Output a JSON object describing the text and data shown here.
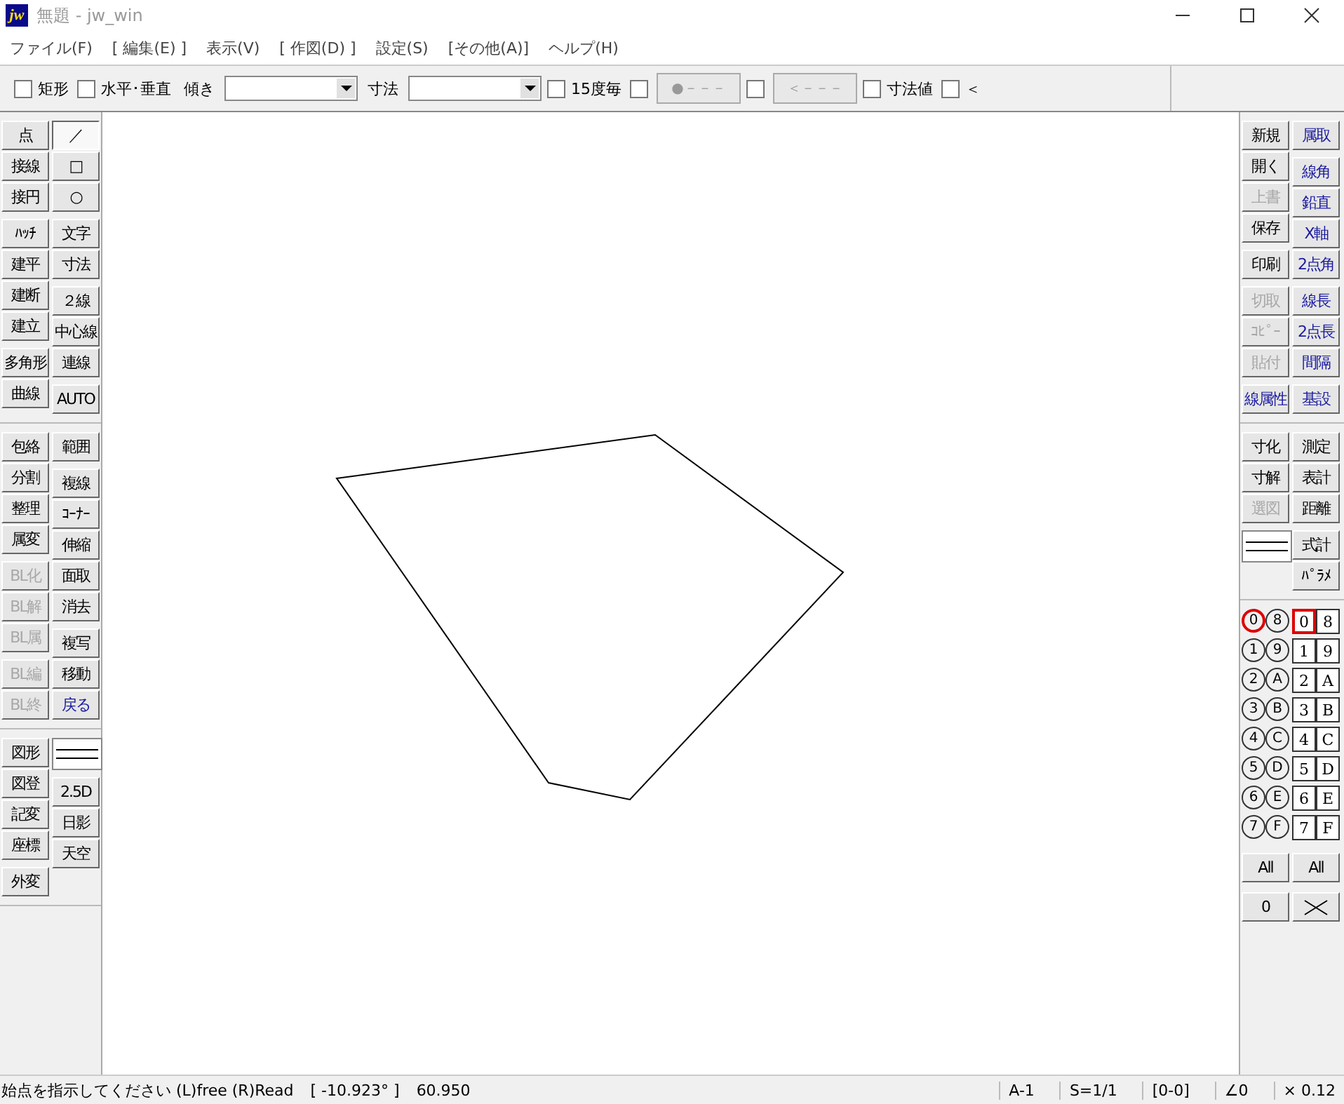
{
  "window": {
    "logo": "jw",
    "title": "無題 - jw_win"
  },
  "menu": [
    "ファイル(F)",
    "[ 編集(E) ]",
    "表示(V)",
    "[ 作図(D) ]",
    "設定(S)",
    "[その他(A)]",
    "ヘルプ(H)"
  ],
  "toolbar": [
    {
      "kind": "checkbox",
      "label": "矩形",
      "checked": false
    },
    {
      "kind": "checkbox",
      "label": "水平･垂直",
      "checked": false
    },
    {
      "kind": "label",
      "label": "傾き"
    },
    {
      "kind": "combo"
    },
    {
      "kind": "label",
      "label": "寸法"
    },
    {
      "kind": "combo"
    },
    {
      "kind": "checkbox",
      "label": "15度毎",
      "checked": false
    },
    {
      "kind": "checkbox",
      "checked": false
    },
    {
      "kind": "button",
      "label": "●－－－",
      "disabled": true
    },
    {
      "kind": "checkbox",
      "checked": false
    },
    {
      "kind": "button",
      "label": "＜－－－",
      "disabled": true
    },
    {
      "kind": "checkbox",
      "label": "寸法値",
      "checked": false
    },
    {
      "kind": "checkbox",
      "label": "＜",
      "checked": false
    }
  ],
  "left_panel": [
    {
      "col1": [
        [
          {
            "label": "点",
            "disabled": false,
            "accent": false
          },
          {
            "label": "接線",
            "disabled": false,
            "accent": false
          },
          {
            "label": "接円",
            "disabled": false,
            "accent": false
          }
        ],
        [
          {
            "label": "ﾊｯﾁ",
            "disabled": false,
            "accent": false
          },
          {
            "label": "建平",
            "disabled": false,
            "accent": false
          },
          {
            "label": "建断",
            "disabled": false,
            "accent": false
          },
          {
            "label": "建立",
            "disabled": false,
            "accent": false
          }
        ],
        [
          {
            "label": "多角形",
            "disabled": false,
            "accent": false
          },
          {
            "label": "曲線",
            "disabled": false,
            "accent": false
          }
        ]
      ],
      "col2": [
        [
          {
            "label": "／",
            "disabled": false,
            "accent": false,
            "selected": true
          },
          {
            "label": "□",
            "disabled": false,
            "accent": false,
            "selected": false
          },
          {
            "label": "○",
            "disabled": false,
            "accent": false,
            "selected": false
          }
        ],
        [
          {
            "label": "文字",
            "disabled": false,
            "accent": false
          },
          {
            "label": "寸法",
            "disabled": false,
            "accent": false
          }
        ],
        [
          {
            "label": "２線",
            "disabled": false,
            "accent": false
          },
          {
            "label": "中心線",
            "disabled": false,
            "accent": false
          },
          {
            "label": "連線",
            "disabled": false,
            "accent": false
          }
        ],
        [
          {
            "label": "AUTO",
            "disabled": false,
            "accent": false
          }
        ]
      ]
    },
    {
      "col1": [
        [
          {
            "label": "包絡",
            "disabled": false,
            "accent": false
          },
          {
            "label": "分割",
            "disabled": false,
            "accent": false
          },
          {
            "label": "整理",
            "disabled": false,
            "accent": false
          },
          {
            "label": "属変",
            "disabled": false,
            "accent": false
          }
        ],
        [
          {
            "label": "BL化",
            "disabled": true,
            "accent": false
          },
          {
            "label": "BL解",
            "disabled": true,
            "accent": false
          },
          {
            "label": "BL属",
            "disabled": true,
            "accent": false
          }
        ],
        [
          {
            "label": "BL編",
            "disabled": true,
            "accent": false
          },
          {
            "label": "BL終",
            "disabled": true,
            "accent": false
          }
        ]
      ],
      "col2": [
        [
          {
            "label": "範囲",
            "disabled": false,
            "accent": false
          }
        ],
        [
          {
            "label": "複線",
            "disabled": false,
            "accent": false
          },
          {
            "label": "ｺｰﾅｰ",
            "disabled": false,
            "accent": false
          },
          {
            "label": "伸縮",
            "disabled": false,
            "accent": false
          },
          {
            "label": "面取",
            "disabled": false,
            "accent": false
          },
          {
            "label": "消去",
            "disabled": false,
            "accent": false
          }
        ],
        [
          {
            "label": "複写",
            "disabled": false,
            "accent": false
          },
          {
            "label": "移動",
            "disabled": false,
            "accent": false
          },
          {
            "label": "戻る",
            "disabled": false,
            "accent": true
          }
        ]
      ]
    },
    {
      "col1": [
        [
          {
            "label": "図形",
            "disabled": false,
            "accent": false
          },
          {
            "label": "図登",
            "disabled": false,
            "accent": false
          },
          {
            "label": "記変",
            "disabled": false,
            "accent": false
          },
          {
            "label": "座標",
            "disabled": false,
            "accent": false
          }
        ],
        [
          {
            "label": "外変",
            "disabled": false,
            "accent": false
          }
        ]
      ],
      "col2": [
        [
          {
            "kind": "swatch"
          }
        ],
        [
          {
            "label": "2.5D",
            "disabled": false,
            "accent": false
          },
          {
            "label": "日影",
            "disabled": false,
            "accent": false
          },
          {
            "label": "天空",
            "disabled": false,
            "accent": false
          }
        ]
      ]
    }
  ],
  "right_panel": [
    {
      "col1": [
        [
          {
            "label": "新規",
            "disabled": false,
            "accent": false
          },
          {
            "label": "開く",
            "disabled": false,
            "accent": false
          },
          {
            "label": "上書",
            "disabled": true,
            "accent": false
          },
          {
            "label": "保存",
            "disabled": false,
            "accent": false
          }
        ],
        [
          {
            "label": "印刷",
            "disabled": false,
            "accent": false
          }
        ],
        [
          {
            "label": "切取",
            "disabled": true,
            "accent": false
          },
          {
            "label": "ｺﾋﾟｰ",
            "disabled": true,
            "accent": false
          },
          {
            "label": "貼付",
            "disabled": true,
            "accent": false
          }
        ],
        [
          {
            "label": "線属性",
            "disabled": false,
            "accent": true
          }
        ]
      ],
      "col2": [
        [
          {
            "label": "属取",
            "disabled": false,
            "accent": true
          }
        ],
        [
          {
            "label": "線角",
            "disabled": false,
            "accent": true
          },
          {
            "label": "鉛直",
            "disabled": false,
            "accent": true
          },
          {
            "label": "X軸",
            "disabled": false,
            "accent": true
          },
          {
            "label": "2点角",
            "disabled": false,
            "accent": true
          }
        ],
        [
          {
            "label": "線長",
            "disabled": false,
            "accent": true
          },
          {
            "label": "2点長",
            "disabled": false,
            "accent": true
          },
          {
            "label": "間隔",
            "disabled": false,
            "accent": true
          }
        ],
        [
          {
            "label": "基設",
            "disabled": false,
            "accent": true
          }
        ]
      ]
    },
    {
      "col1": [
        [
          {
            "label": "寸化",
            "disabled": false,
            "accent": false
          },
          {
            "label": "寸解",
            "disabled": false,
            "accent": false
          },
          {
            "label": "選図",
            "disabled": true,
            "accent": false
          }
        ],
        [
          {
            "kind": "swatch"
          }
        ]
      ],
      "col2": [
        [
          {
            "label": "測定",
            "disabled": false,
            "accent": false
          },
          {
            "label": "表計",
            "disabled": false,
            "accent": false
          },
          {
            "label": "距離",
            "disabled": false,
            "accent": false
          }
        ],
        [
          {
            "label": "式計",
            "disabled": false,
            "accent": false
          },
          {
            "label": "ﾊﾟﾗﾒ",
            "disabled": false,
            "accent": false
          }
        ]
      ]
    }
  ],
  "layers": {
    "groups": [
      {
        "label": "0",
        "selected": true
      },
      {
        "label": "1",
        "selected": false
      },
      {
        "label": "2",
        "selected": false
      },
      {
        "label": "3",
        "selected": false
      },
      {
        "label": "4",
        "selected": false
      },
      {
        "label": "5",
        "selected": false
      },
      {
        "label": "6",
        "selected": false
      },
      {
        "label": "7",
        "selected": false
      },
      {
        "label": "8",
        "selected": false
      },
      {
        "label": "9",
        "selected": false
      },
      {
        "label": "A",
        "selected": false
      },
      {
        "label": "B",
        "selected": false
      },
      {
        "label": "C",
        "selected": false
      },
      {
        "label": "D",
        "selected": false
      },
      {
        "label": "E",
        "selected": false
      },
      {
        "label": "F",
        "selected": false
      }
    ],
    "group_all": "All",
    "group_zero": "0",
    "layers": [
      {
        "label": "0",
        "selected": true
      },
      {
        "label": "1",
        "selected": false
      },
      {
        "label": "2",
        "selected": false
      },
      {
        "label": "3",
        "selected": false
      },
      {
        "label": "4",
        "selected": false
      },
      {
        "label": "5",
        "selected": false
      },
      {
        "label": "6",
        "selected": false
      },
      {
        "label": "7",
        "selected": false
      },
      {
        "label": "8",
        "selected": false
      },
      {
        "label": "9",
        "selected": false
      },
      {
        "label": "A",
        "selected": false
      },
      {
        "label": "B",
        "selected": false
      },
      {
        "label": "C",
        "selected": false
      },
      {
        "label": "D",
        "selected": false
      },
      {
        "label": "E",
        "selected": false
      },
      {
        "label": "F",
        "selected": false
      }
    ],
    "layer_all": "All"
  },
  "status_bar": {
    "message": "始点を指示してください (L)free (R)Read",
    "angle": "[ -10.923° ]",
    "length": "60.950",
    "paper": "A-1",
    "scale": "S=1/1",
    "layer": "[0-0]",
    "rotation": "∠0",
    "zoom": "× 0.12"
  }
}
